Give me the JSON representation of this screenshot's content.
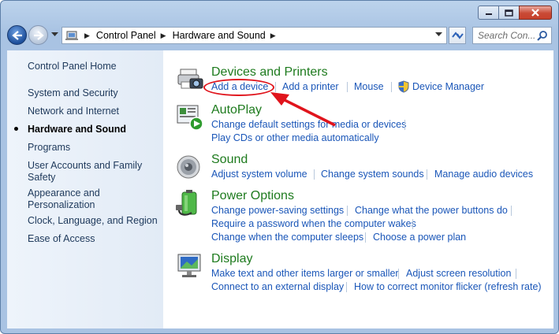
{
  "window": {
    "colors": {
      "link": "#1a56b8",
      "title_green": "#1e7b1e",
      "sidebar_text": "#1e395b",
      "annotation": "#e0141c"
    }
  },
  "address": {
    "crumbs": [
      "Control Panel",
      "Hardware and Sound"
    ]
  },
  "search": {
    "placeholder": "Search Con..."
  },
  "sidebar": {
    "home": "Control Panel Home",
    "items": [
      "System and Security",
      "Network and Internet",
      "Hardware and Sound",
      "Programs",
      "User Accounts and Family Safety",
      "Appearance and Personalization",
      "Clock, Language, and Region",
      "Ease of Access"
    ],
    "active_index": 2
  },
  "categories": {
    "devices": {
      "title": "Devices and Printers",
      "icon": "printer-camera-icon",
      "tasks": [
        "Add a device",
        "Add a printer",
        "Mouse",
        "Device Manager"
      ]
    },
    "autoplay": {
      "title": "AutoPlay",
      "icon": "autoplay-icon",
      "tasks": [
        "Change default settings for media or devices",
        "Play CDs or other media automatically"
      ]
    },
    "sound": {
      "title": "Sound",
      "icon": "speaker-icon",
      "tasks": [
        "Adjust system volume",
        "Change system sounds",
        "Manage audio devices"
      ]
    },
    "power": {
      "title": "Power Options",
      "icon": "battery-plug-icon",
      "tasks": [
        "Change power-saving settings",
        "Change what the power buttons do",
        "Require a password when the computer wakes",
        "Change when the computer sleeps",
        "Choose a power plan"
      ]
    },
    "display": {
      "title": "Display",
      "icon": "monitor-icon",
      "tasks": [
        "Make text and other items larger or smaller",
        "Adjust screen resolution",
        "Connect to an external display",
        "How to correct monitor flicker (refresh rate)"
      ]
    }
  }
}
